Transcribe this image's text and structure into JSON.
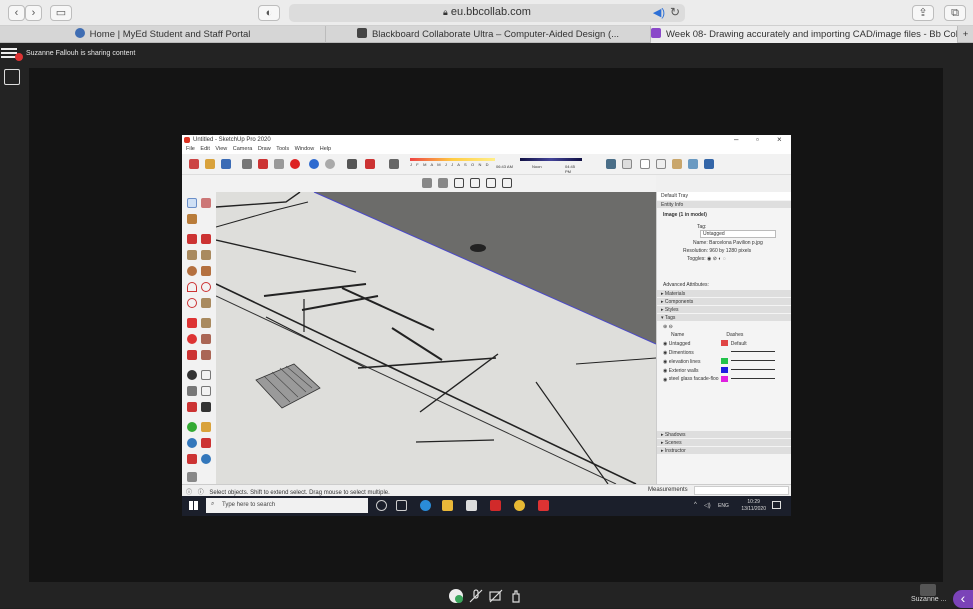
{
  "browser": {
    "url": "eu.bbcollab.com",
    "tabs": [
      {
        "label": "Home | MyEd Student and Staff Portal",
        "icon_color": "#3f6db3"
      },
      {
        "label": "Blackboard Collaborate Ultra – Computer-Aided Design (...",
        "icon_color": "#444444"
      },
      {
        "label": "Week 08- Drawing accurately and importing CAD/image files - Bb Collabor...",
        "icon_color": "#8a48c9",
        "active": true
      }
    ]
  },
  "collab": {
    "share_note": "Suzanne Fallouh is sharing content",
    "presenter_chip": "Suzanne ..."
  },
  "sketchup": {
    "title": "Untitled - SketchUp Pro 2020",
    "menu": [
      "File",
      "Edit",
      "View",
      "Camera",
      "Draw",
      "Tools",
      "Window",
      "Help"
    ],
    "shadow_months": "J F M A M J J A S O N D",
    "time_start": "06:43 AM",
    "time_mid": "Noon",
    "time_end": "04:45 PM",
    "tray": {
      "title": "Default Tray",
      "entity_info": "Entity Info",
      "entity_name": "Image (1 in model)",
      "tag_label": "Tag:",
      "tag_value": "Untagged",
      "name_label": "Name:",
      "name_value": "Barcelona Pavilion p.jpg",
      "resolution_label": "Resolution:",
      "resolution_value": "960 by 1280 pixels",
      "toggles_label": "Toggles:",
      "advanced": "Advanced Attributes:",
      "sections": [
        "Materials",
        "Components",
        "Styles",
        "Tags"
      ],
      "tags_header": {
        "name": "Name",
        "dashes": "Dashes"
      },
      "tags": [
        {
          "name": "Untagged",
          "color": "#e04545",
          "dash": "Default"
        },
        {
          "name": "Dimentions",
          "color": "",
          "dash": ""
        },
        {
          "name": "elevation lines",
          "color": "#22c24a",
          "dash": ""
        },
        {
          "name": "Exterior walls",
          "color": "#1d1de0",
          "dash": ""
        },
        {
          "name": "steel glass facade-floo",
          "color": "#e020e0",
          "dash": ""
        }
      ],
      "bottom_sections": [
        "Shadows",
        "Scenes",
        "Instructor"
      ]
    },
    "status": "Select objects. Shift to extend select. Drag mouse to select multiple.",
    "measurements": "Measurements"
  },
  "taskbar": {
    "search_placeholder": "Type here to search",
    "lang": "ENG",
    "time": "10:29",
    "date": "13/11/2020"
  }
}
